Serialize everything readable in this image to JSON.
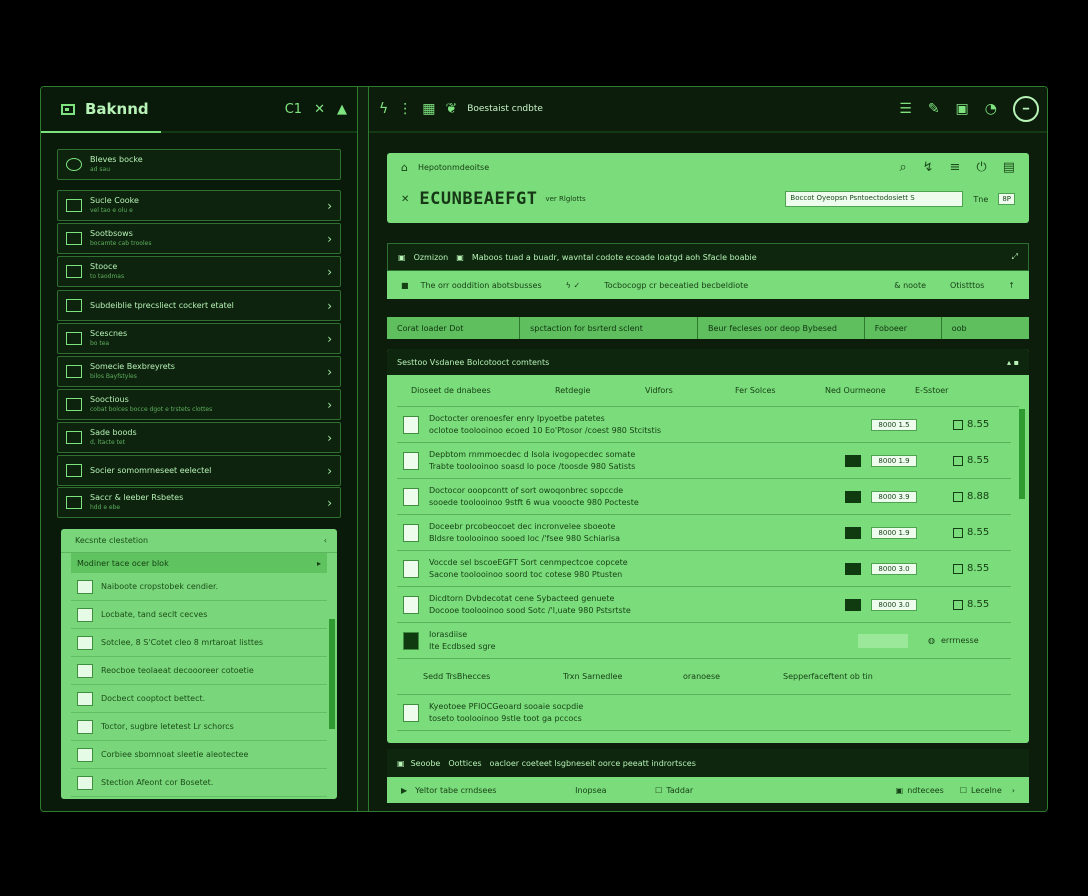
{
  "left": {
    "title": "Baknnd",
    "controls": [
      "C1",
      "✕",
      "▲"
    ],
    "items": [
      {
        "l1": "Bleves bocke",
        "l2": "ad sau"
      },
      {
        "l1": "Sucle Cooke",
        "l2": "vel tao e olu e"
      },
      {
        "l1": "Sootbsows",
        "l2": "bocamte cab trooles"
      },
      {
        "l1": "Stooce",
        "l2": "to taodmas"
      },
      {
        "l1": "Subdeiblie tprecsliect cockert etatel",
        "l2": ""
      },
      {
        "l1": "Scescnes",
        "l2": "bo tea"
      },
      {
        "l1": "Somecie Bexbreyrets",
        "l2": "bilos Bayfstyles"
      },
      {
        "l1": "Sooctious",
        "l2": "cobat bolces bocce dgot e trstets clottes"
      },
      {
        "l1": "Sade boods",
        "l2": "d, ltacte tet"
      },
      {
        "l1": "Socier somomrneseet eelectel",
        "l2": ""
      },
      {
        "l1": "Saccr & leeber Rsbetes",
        "l2": "hdd e ebe"
      }
    ],
    "panel": {
      "header": "Kecsnte clestetion",
      "selected": "Modiner tace ocer blok",
      "rows": [
        "Naiboote cropstobek cendier.",
        "Locbate, tand seclt cecves",
        "Sotclee, 8 S'Cotet cleo 8 mrtaroat listtes",
        "Reocboe teolaeat decoooreer cotoetie",
        "Docbect cooptoct bettect.",
        "Toctor, sugbre letetest Lr schorcs",
        "Corbiee sbomnoat sleetie aleotectee",
        "Stection Afeont cor Bosetet."
      ]
    }
  },
  "top": {
    "title": "Boestaist cndbte"
  },
  "card1": {
    "label": "Hepotonmdeoitse",
    "heading": "ECUNBEAEFGT",
    "sub": "ver Rlglotts",
    "input": "Boccot Oyeopsn Psntoectodosiett",
    "input_suffix": "S",
    "time": "Tne",
    "btn": "8P"
  },
  "strip1": {
    "a": "Ozmizon",
    "b": "Maboos tuad a buadr, wavntal codote ecoade loatgd aoh Sfacle boabie"
  },
  "strip2": {
    "a": "The orr ooddition abotsbusses",
    "b": "Tocbocogp cr beceatied becbeldiote",
    "c": "& noote",
    "d": "Otistttos"
  },
  "tabs": [
    "Corat loader Dot",
    "spctaction for bsrterd sclent",
    "Beur fecleses oor deop Bybesed",
    "Foboeer",
    "oob"
  ],
  "table": {
    "bar": "Sesttoo  Vsdanee  Bolcotooct comtents",
    "headers": [
      "Dioseet de dnabees",
      "Retdegie",
      "Vidfors",
      "Fer Solces",
      "Ned Ourmeone",
      "E-Sstoer"
    ],
    "rows": [
      {
        "a": "Doctocter orenoesfer enry Ipyoetbe  patetes",
        "b": "oclotoe  toolooinoo  ecoed  10 Eo'Ptosor  /coest  980 Stcitstis",
        "pill": "8000 1.5",
        "val": "8.55",
        "mark": false
      },
      {
        "a": "Depbtom  rnmmoecdec  d Isola  ivogopecdec  somate",
        "b": "Trabte  toolooinoo  soasd  lo poce  /toosde  980 Satists",
        "pill": "8000 1.9",
        "val": "8.55",
        "mark": true
      },
      {
        "a": "Doctocor  ooopcontt of sort  owoqonbrec  sopccde",
        "b": "sooede  toolooinoo  9stft  6 wua  vooocte  980 Pocteste",
        "pill": "8000 3.9",
        "val": "8.88",
        "mark": true
      },
      {
        "a": "Doceebr  prcobeocoet dec  incronvelee  sboeote",
        "b": "Bldsre  toolooinoo  sooed  loc  /'fsee  980 Schiarisa",
        "pill": "8000 1.9",
        "val": "8.55",
        "mark": true
      },
      {
        "a": "Voccde  sel  bscoeEGFT Sort  cenmpectcoe  copcete",
        "b": "Sacone  toolooinoo  soord  toc  cotese  980 Ptusten",
        "pill": "8000 3.0",
        "val": "8.55",
        "mark": true
      },
      {
        "a": "Dicdtorn  Dvbdecotat cene  Sybacteed  genuete",
        "b": "Docooe  toolooinoo  sood  Sotc  /'l,uate  980 Pstsrtste",
        "pill": "8000 3.0",
        "val": "8.55",
        "mark": true
      }
    ],
    "special": {
      "a": "Iorasdiise",
      "b": "Ite Ecdbsed sgre",
      "action": "errrnesse"
    },
    "footer": [
      "Sedd TrsBhecces",
      "Trxn Sarnedlee",
      "oranoese",
      "Sepperfaceftent ob tin"
    ],
    "last": {
      "a": "Kyeotoee  PFIOCGeoard  sooaie  socpdie",
      "b": "toseto  toolooinoo  9stle  toot  ga  pccocs"
    }
  },
  "bottom": {
    "a": "Seoobe",
    "b": "Oottices",
    "c": "oacloer coeteet lsgbneseit  oorce peeatt indrortsces",
    "d": "Yeltor tabe crndsees",
    "e": "Inopsea",
    "f": "Taddar",
    "g": "ndtecees",
    "h": "Lecelne"
  }
}
